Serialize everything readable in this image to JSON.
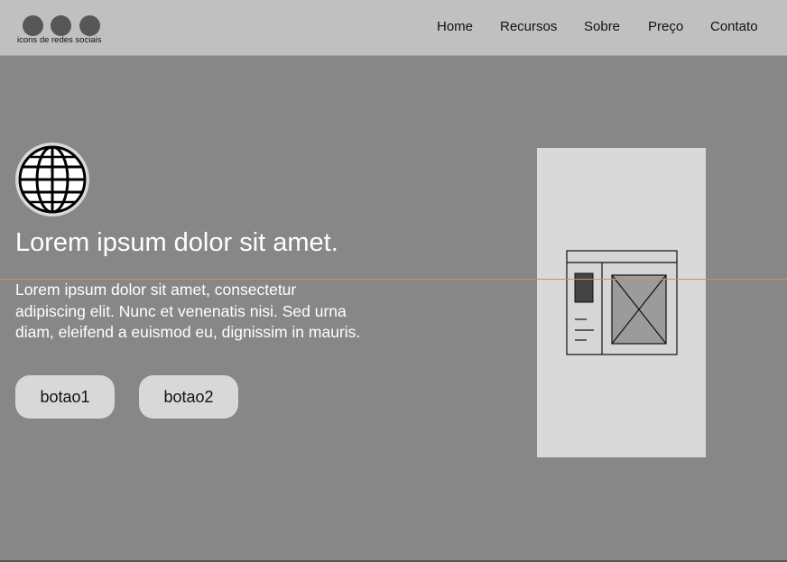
{
  "header": {
    "social": {
      "label": "icons de redes sociais",
      "icons": [
        "social-icon",
        "social-icon",
        "social-icon"
      ]
    },
    "nav": [
      "Home",
      "Recursos",
      "Sobre",
      "Preço",
      "Contato"
    ]
  },
  "hero": {
    "icon": "globe-icon",
    "title": "Lorem ipsum dolor sit amet.",
    "text": "Lorem ipsum dolor sit amet, consectetur adipiscing elit. Nunc et venenatis nisi. Sed urna diam, eleifend a euismod eu, dignissim in mauris.",
    "buttons": [
      "botao1",
      "botao2"
    ]
  },
  "preview": {
    "icon": "wireframe-image-icon"
  },
  "colors": {
    "background": "#878787",
    "header": "#c0c0c0",
    "button": "#d8d8d8",
    "card": "#d9d9d9",
    "guide_line": "#d9886f"
  }
}
